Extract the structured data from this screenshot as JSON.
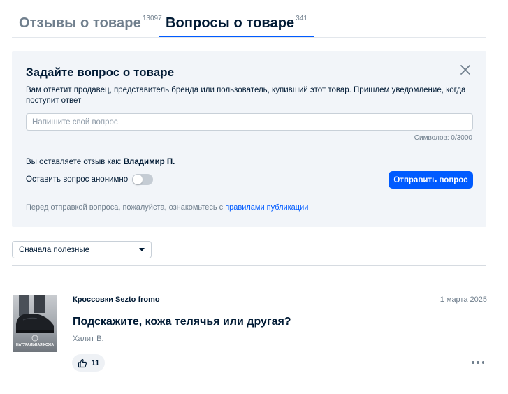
{
  "tabs": [
    {
      "label": "Отзывы о товаре",
      "count": "13097",
      "active": false
    },
    {
      "label": "Вопросы о товаре",
      "count": "341",
      "active": true
    }
  ],
  "ask": {
    "title": "Задайте вопрос о товаре",
    "description": "Вам ответит продавец, представитель бренда или пользователь, купивший этот товар. Пришлем уведомление, когда поступит ответ",
    "input_placeholder": "Напишите свой вопрос",
    "input_value": "",
    "char_counter": "Символов: 0/3000",
    "reviewer_prefix": "Вы оставляете отзыв как:",
    "reviewer_name": "Владимир П.",
    "anonymous_label": "Оставить вопрос анонимно",
    "anonymous_on": false,
    "send_label": "Отправить вопрос",
    "rules_prefix": "Перед отправкой вопроса, пожалуйста, ознакомьтесь с",
    "rules_link": "правилами публикации"
  },
  "sort": {
    "selected": "Сначала полезные"
  },
  "questions": [
    {
      "product": "Кроссовки Sezto fromo",
      "date": "1 марта 2025",
      "text": "Подскажите, кожа телячья или другая?",
      "author": "Халит В.",
      "likes": "11",
      "thumb_caption": "Натуральная кожа"
    }
  ],
  "colors": {
    "accent": "#005bff",
    "panel_bg": "#f2f5f9",
    "text_primary": "#001a34",
    "text_secondary": "#707f8d"
  },
  "icons": [
    "close-icon",
    "thumbs-up-icon",
    "more-dots-icon",
    "chevron-down-icon"
  ]
}
